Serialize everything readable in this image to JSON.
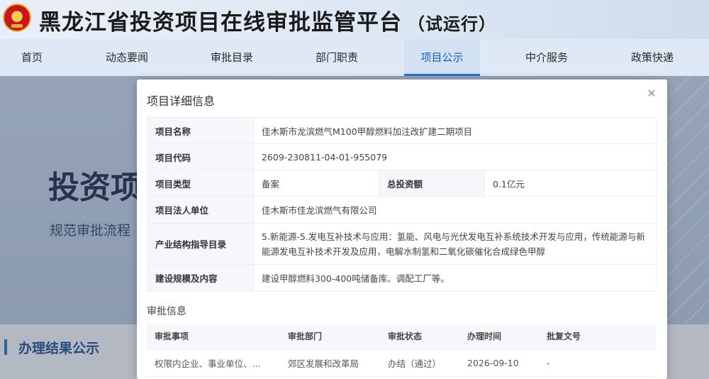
{
  "header": {
    "title": "黑龙江省投资项目在线审批监管平台",
    "subtitle": "（试运行）"
  },
  "nav": {
    "items": [
      {
        "label": "首页"
      },
      {
        "label": "动态要闻"
      },
      {
        "label": "审批目录"
      },
      {
        "label": "部门职责"
      },
      {
        "label": "项目公示",
        "active": true
      },
      {
        "label": "中介服务"
      },
      {
        "label": "政策快递"
      }
    ]
  },
  "banner": {
    "title": "投资项",
    "subtitle": "规范审批流程"
  },
  "section": {
    "title": "办理结果公示"
  },
  "modal": {
    "title": "项目详细信息",
    "close_icon": "close-icon",
    "details": {
      "name_label": "项目名称",
      "name_value": "佳木斯市龙滨燃气M100甲醇燃料加注改扩建二期项目",
      "code_label": "项目代码",
      "code_value": "2609-230811-04-01-955079",
      "type_label": "项目类型",
      "type_value": "备案",
      "invest_label": "总投资额",
      "invest_value": "0.1亿元",
      "legal_label": "项目法人单位",
      "legal_value": "佳木斯市佳龙滨燃气有限公司",
      "industry_label": "产业结构指导目录",
      "industry_value": "5.新能源-5.发电互补技术与应用：氢能、风电与光伏发电互补系统技术开发与应用，传统能源与新能源发电互补技术开发及应用，电解水制氢和二氧化碳催化合成绿色甲醇",
      "scale_label": "建设规模及内容",
      "scale_value": "建设甲醇燃料300-400吨储备库、调配工厂等。"
    },
    "approval": {
      "heading": "审批信息",
      "columns": [
        "审批事项",
        "审批部门",
        "审批状态",
        "办理时间",
        "批复文号"
      ],
      "rows": [
        [
          "权限内企业、事业单位、…",
          "郊区发展和改革局",
          "办结（通过）",
          "2026-09-10",
          "-"
        ]
      ]
    }
  }
}
